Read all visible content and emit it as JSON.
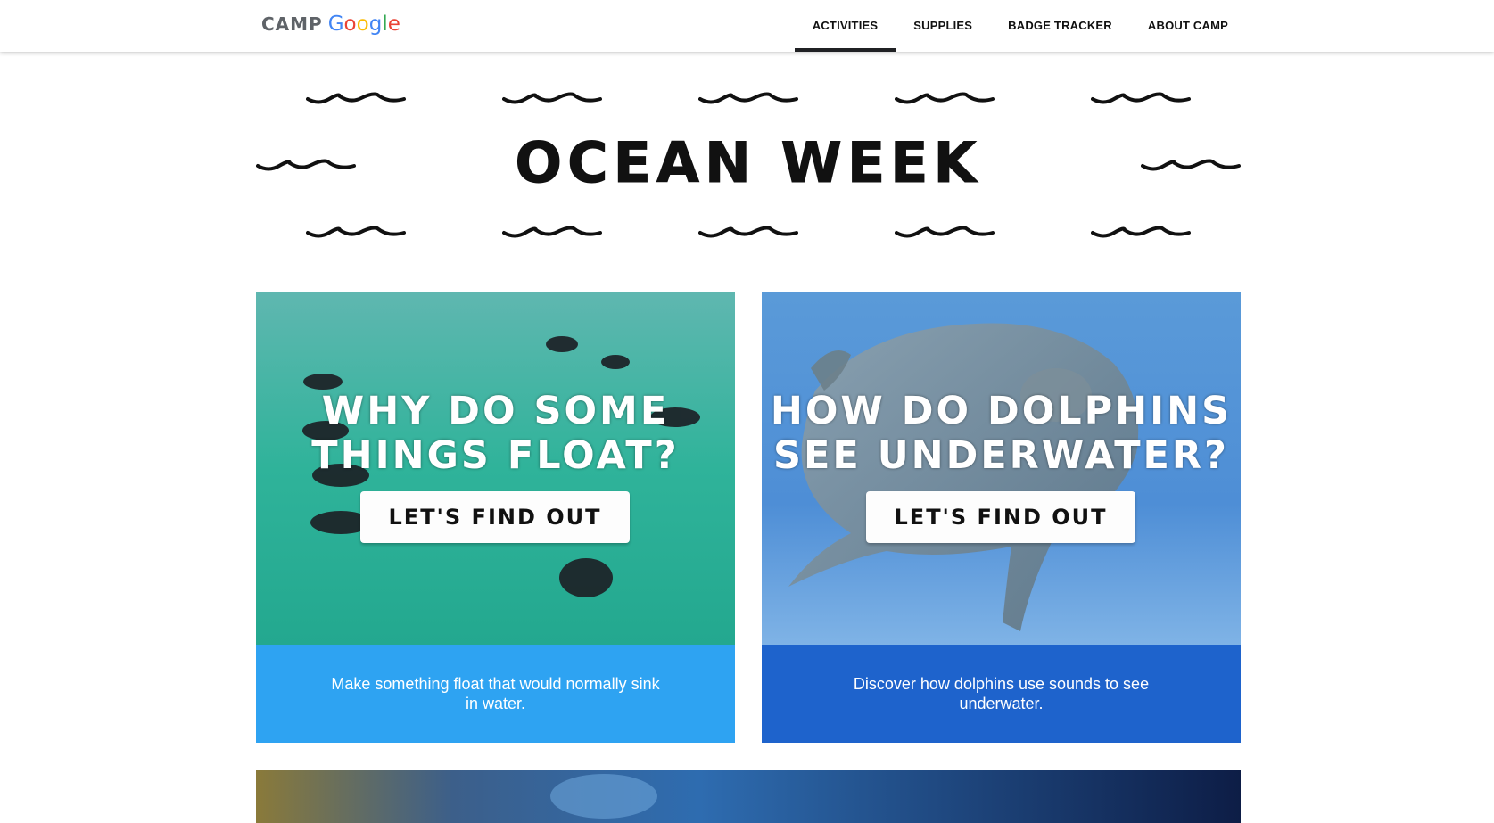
{
  "nav": {
    "logo_camp": "CAMP",
    "logo_google": [
      "G",
      "o",
      "o",
      "g",
      "l",
      "e"
    ],
    "items": [
      {
        "label": "ACTIVITIES",
        "active": true
      },
      {
        "label": "SUPPLIES",
        "active": false
      },
      {
        "label": "BADGE TRACKER",
        "active": false
      },
      {
        "label": "ABOUT CAMP",
        "active": false
      }
    ]
  },
  "hero": {
    "title": "OCEAN WEEK"
  },
  "cards": [
    {
      "question_line1": "WHY DO SOME",
      "question_line2": "THINGS FLOAT?",
      "button": "LET'S FIND OUT",
      "description": "Make something float that would normally sink in water.",
      "footer_color": "#2ea3f2",
      "image_subject": "penguins swimming in turquoise water"
    },
    {
      "question_line1": "HOW DO DOLPHINS",
      "question_line2": "SEE UNDERWATER?",
      "button": "LET'S FIND OUT",
      "description": "Discover how dolphins use sounds to see underwater.",
      "footer_color": "#1e63cc",
      "image_subject": "dolphin swimming in blue water"
    }
  ],
  "colors": {
    "nav_active_underline": "#202124",
    "text_dark": "#111111"
  }
}
